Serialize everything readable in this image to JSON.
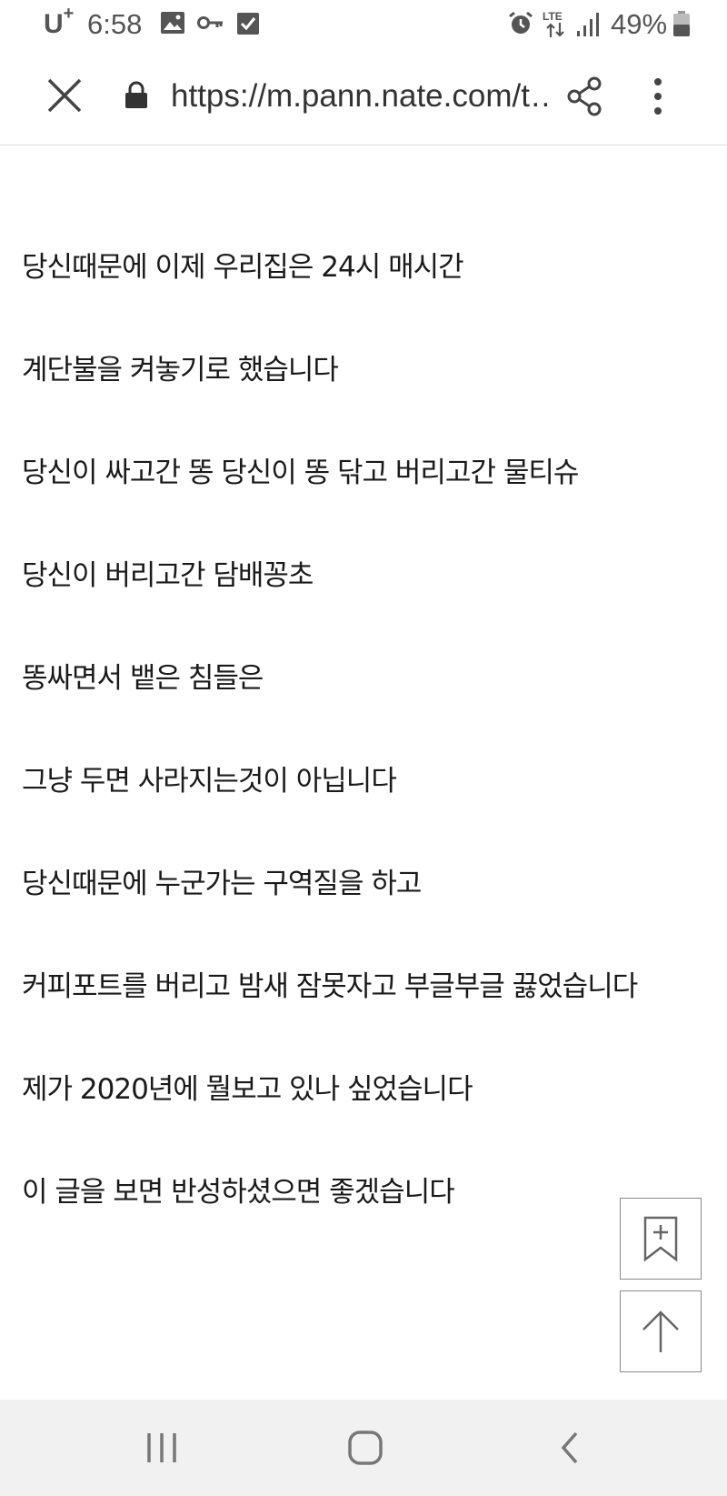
{
  "status_bar": {
    "carrier": "U",
    "carrier_plus": "+",
    "time": "6:58",
    "icons": [
      "image-icon",
      "key-icon",
      "checkbox-icon",
      "alarm-icon",
      "lte-icon",
      "signal-icon",
      "battery-icon"
    ],
    "network": "LTE",
    "battery": "49%"
  },
  "browser": {
    "url": "https://m.pann.nate.com/t…"
  },
  "article": {
    "lines": [
      "당신때문에 이제 우리집은 24시 매시간",
      "계단불을 켜놓기로 했습니다",
      "당신이 싸고간 똥 당신이 똥 닦고 버리고간 물티슈",
      "당신이 버리고간 담배꽁초",
      "똥싸면서 뱉은 침들은",
      "그냥 두면 사라지는것이 아닙니다",
      "당신때문에 누군가는 구역질을 하고",
      "커피포트를 버리고 밤새 잠못자고 부글부글 끓었습니다",
      "제가 2020년에 뭘보고 있나 싶었습니다",
      "이 글을 보면 반성하셨으면 좋겠습니다"
    ]
  }
}
